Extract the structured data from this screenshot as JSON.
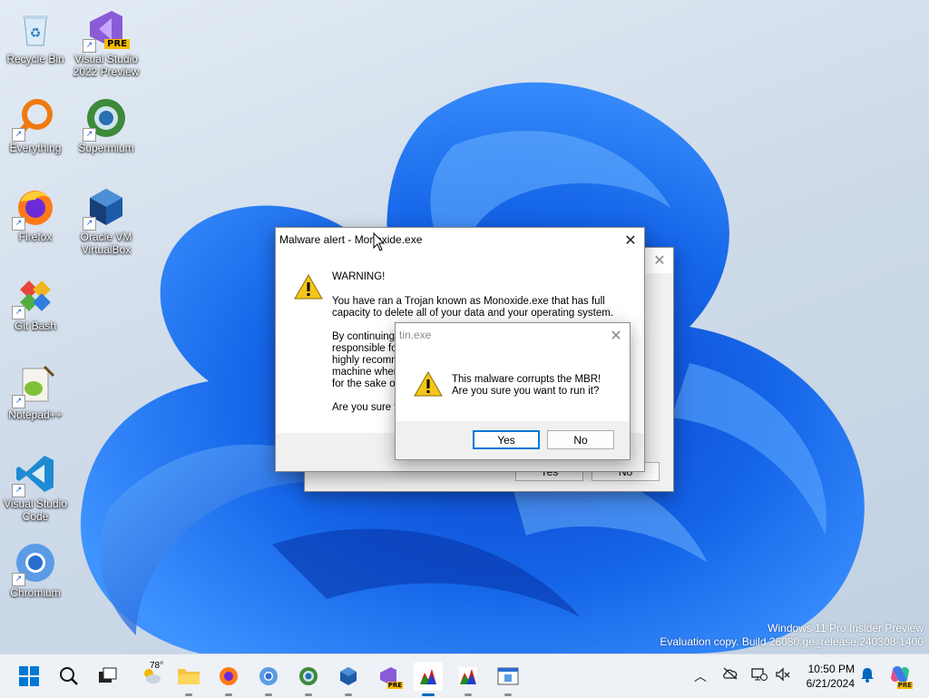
{
  "desktop": {
    "icons": [
      {
        "label": "Recycle Bin"
      },
      {
        "label": "Visual Studio\n2022 Preview",
        "badge": "PRE"
      },
      {
        "label": "Everything"
      },
      {
        "label": "Supermium"
      },
      {
        "label": "Firefox"
      },
      {
        "label": "Oracle VM\nVirtualBox"
      },
      {
        "label": "Git Bash"
      },
      {
        "label": "Notepad++"
      },
      {
        "label": "Visual Studio\nCode"
      },
      {
        "label": "Chromium"
      }
    ],
    "watermark": {
      "line1": "Windows 11 Pro Insider Preview",
      "line2": "Evaluation copy. Build 26080.ge_release.240308-1400"
    }
  },
  "dialogs": {
    "malware_alert": {
      "title": "Malware alert - Monoxide.exe",
      "heading": "WARNING!",
      "para1": "You have ran a Trojan known as Monoxide.exe that has full\ncapacity to delete all of your data and your operating system.",
      "para2": "By continuing\nresponsible fo\nhighly recomm\nmachine wher\nfor the sake o",
      "para3": "Are you sure y"
    },
    "back_dialog": {
      "yes": "Yes",
      "no": "No"
    },
    "tin": {
      "title": "tin.exe",
      "message": "This malware corrupts the MBR!\nAre you sure you want to run it?",
      "yes": "Yes",
      "no": "No"
    }
  },
  "taskbar": {
    "weather_temp": "78°",
    "clock_time": "10:50 PM",
    "clock_date": "6/21/2024",
    "pre_badge": "PRE"
  },
  "colors": {
    "accent": "#0078d4",
    "taskbar": "#eef1f6",
    "warning": "#f5c518"
  }
}
